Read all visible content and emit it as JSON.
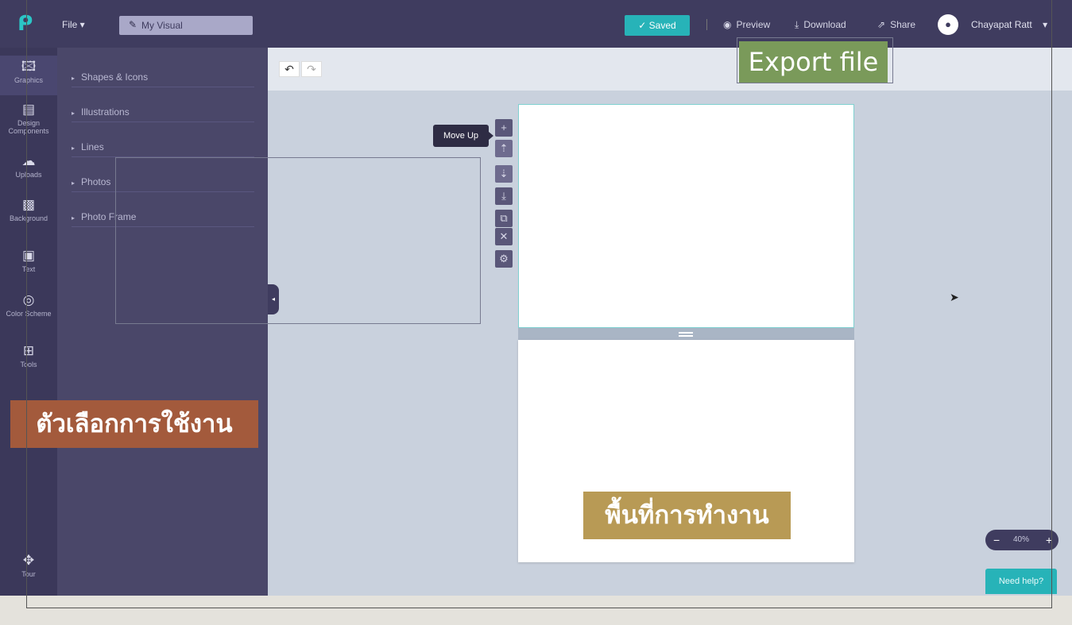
{
  "topbar": {
    "logo_icon": "p-logo-icon",
    "file_menu": "File ▾",
    "doc_title": "My Visual",
    "saved_button": "✓ Saved",
    "preview": "Preview",
    "download": "Download",
    "share": "Share",
    "user_name": "Chayapat Ratt"
  },
  "rail": {
    "items": [
      {
        "label": "Graphics",
        "icon": "image-icon"
      },
      {
        "label": "Design Components",
        "icon": "components-icon"
      },
      {
        "label": "Uploads",
        "icon": "cloud-upload-icon"
      },
      {
        "label": "Background",
        "icon": "background-icon"
      },
      {
        "label": "Text",
        "icon": "text-icon"
      },
      {
        "label": "Color Scheme",
        "icon": "palette-icon"
      },
      {
        "label": "Tools",
        "icon": "toolbox-icon"
      },
      {
        "label": "Tour",
        "icon": "compass-icon"
      }
    ]
  },
  "panel": {
    "items": [
      "Shapes & Icons",
      "Illustrations",
      "Lines",
      "Photos",
      "Photo Frame"
    ]
  },
  "canvas": {
    "tooltip": "Move Up"
  },
  "zoom": {
    "minus": "−",
    "value": "40%",
    "plus": "+"
  },
  "help_button": "Need help?",
  "annotations": {
    "export": "Export file",
    "options": "ตัวเลือกการใช้งาน",
    "workspace": "พื้นที่การทำงาน"
  },
  "colors": {
    "topbar": "#3f3c5f",
    "accent": "#27b3b8",
    "export_label": "#7a9a5a",
    "options_label": "#a35a3c",
    "workspace_label": "#b89a55"
  }
}
